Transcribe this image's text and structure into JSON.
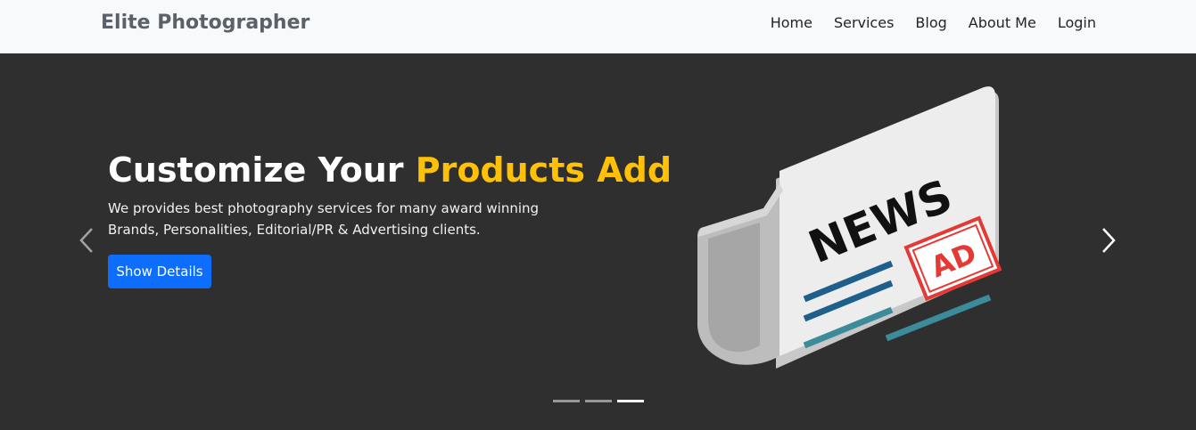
{
  "navbar": {
    "brand": "Elite Photographer",
    "links": [
      {
        "label": "Home"
      },
      {
        "label": "Services"
      },
      {
        "label": "Blog"
      },
      {
        "label": "About Me"
      },
      {
        "label": "Login"
      }
    ]
  },
  "carousel": {
    "slide": {
      "headline_prefix": "Customize Your ",
      "headline_highlight": "Products Add",
      "description": "We provides best photography services for many award winning Brands, Personalities, Editorial/PR & Advertising clients.",
      "button_label": "Show Details",
      "image": {
        "word_news": "NEWS",
        "word_ad": "AD"
      }
    },
    "indicator_count": 3,
    "active_index": 2,
    "icons": {
      "prev": "chevron-left-icon",
      "next": "chevron-right-icon"
    }
  },
  "colors": {
    "navbar_bg": "#f8f9fa",
    "brand": "#5a6168",
    "hero_bg": "#2f2f2f",
    "highlight": "#ffc107",
    "button": "#0d6efd",
    "ad_red": "#e53935"
  }
}
